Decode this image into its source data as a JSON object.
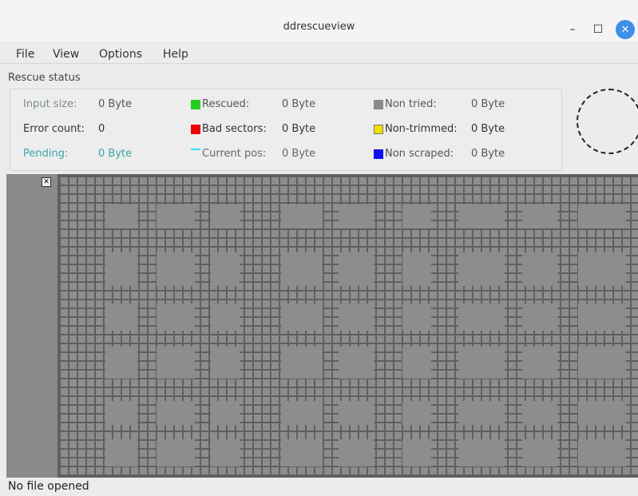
{
  "window": {
    "title": "ddrescueview",
    "minimize_glyph": "–",
    "maximize_glyph": "☐",
    "close_glyph": "✕"
  },
  "menu": {
    "items": [
      "File",
      "View",
      "Options",
      "Help"
    ]
  },
  "rescue_status": {
    "label": "Rescue status",
    "input_size_label": "Input size:",
    "input_size_value": "0 Byte",
    "error_count_label": "Error count:",
    "error_count_value": "0",
    "pending_label": "Pending:",
    "pending_value": "0 Byte",
    "rescued_label": "Rescued:",
    "rescued_value": "0 Byte",
    "bad_sectors_label": "Bad sectors:",
    "bad_sectors_value": "0 Byte",
    "current_pos_label": "Current pos:",
    "current_pos_value": "0 Byte",
    "non_tried_label": "Non tried:",
    "non_tried_value": "0 Byte",
    "non_trimmed_label": "Non-trimmed:",
    "non_trimmed_value": "0 Byte",
    "non_scraped_label": "Non scraped:",
    "non_scraped_value": "0 Byte"
  },
  "colors": {
    "rescued": "#22cc22",
    "bad_sectors": "#ee0000",
    "current_pos": "#33e0ff",
    "non_tried": "#8a8a8a",
    "non_trimmed": "#f2e000",
    "non_scraped": "#1010ee",
    "pending": "#3aa5a5"
  },
  "block_map": {
    "corner_icon": "close-square-icon"
  },
  "status_bar": {
    "text": "No file opened"
  }
}
